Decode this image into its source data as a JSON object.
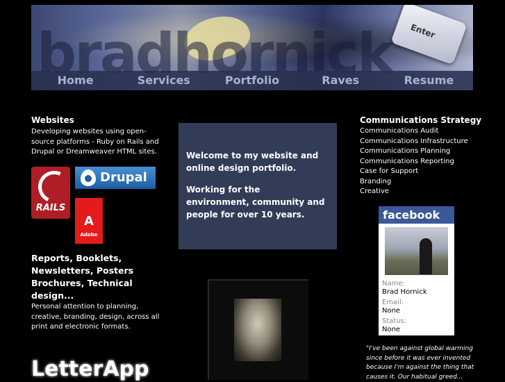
{
  "header": {
    "watermark": "bradhornick",
    "key_label": "Enter",
    "nav": [
      {
        "label": "Home"
      },
      {
        "label": "Services"
      },
      {
        "label": "Portfolio"
      },
      {
        "label": "Raves"
      },
      {
        "label": "Resume"
      }
    ]
  },
  "left": {
    "websites_title": "Websites",
    "websites_text": "Developing websites using open-source platforms - Ruby on Rails and Drupal or Dreamweaver HTML sites.",
    "logos": {
      "rails": "RAILS",
      "drupal": "Drupal",
      "adobe": "Adobe"
    },
    "reports_title": "Reports, Booklets, Newsletters, Posters Brochures, Technical design...",
    "reports_text": "Personal attention to planning, creative, branding, design, across all print and electronic formats.",
    "letterapp": "LetterApp"
  },
  "center": {
    "welcome_line1": "Welcome to my website and online design portfolio.",
    "welcome_line2": "Working for the environment, community and people for over 10 years."
  },
  "right": {
    "cs_title": "Communications Strategy",
    "cs_items": [
      "Communications Audit",
      "Communications Infrastructure",
      "Communications Planning",
      "Communications Reporting",
      "Case for Support",
      "Branding",
      "Creative"
    ],
    "facebook": {
      "brand": "facebook",
      "name_label": "Name:",
      "name_value": "Brad Hornick",
      "email_label": "Email:",
      "email_value": "None",
      "status_label": "Status:",
      "status_value": "None"
    },
    "quote": "\"I've been against global warming since before it was ever invented because I'm against the thing that causes it. Our habitual greed..."
  }
}
